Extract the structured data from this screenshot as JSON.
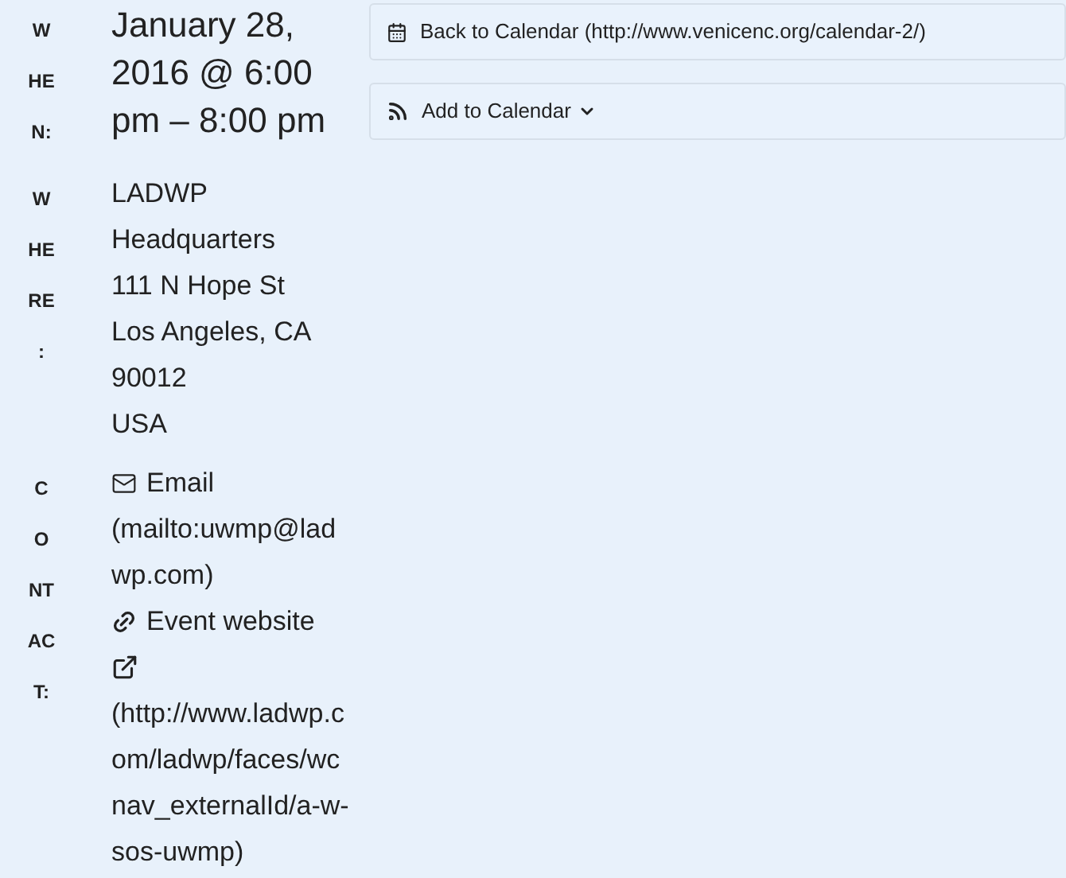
{
  "details": [
    {
      "kind": "when",
      "label_lines": [
        "W",
        "HE",
        "N:"
      ],
      "lines": [
        "January 28, 2016 @ 6:00 pm – 8:00 pm"
      ]
    },
    {
      "kind": "where",
      "label_lines": [
        "W",
        "HE",
        "RE",
        ":"
      ],
      "lines": [
        "LADWP Headquarters",
        "111 N Hope St",
        "Los Angeles, CA",
        "90012",
        "USA"
      ]
    },
    {
      "kind": "contact",
      "label_lines": [
        "C",
        "O",
        "NT",
        "AC",
        "T:"
      ],
      "links": [
        {
          "kind": "email",
          "text": "Email",
          "url": "(mailto:uwmp@ladwp.com)"
        },
        {
          "kind": "website",
          "text": "Event website",
          "url": "(http://www.ladwp.com/ladwp/faces/wcnav_externalId/a-w-sos-uwmp)"
        }
      ]
    }
  ],
  "actions": [
    {
      "kind": "back",
      "text": "Back to Calendar (http://www.venicenc.org/calendar-2/)"
    },
    {
      "kind": "add",
      "text": "Add to Calendar"
    }
  ]
}
